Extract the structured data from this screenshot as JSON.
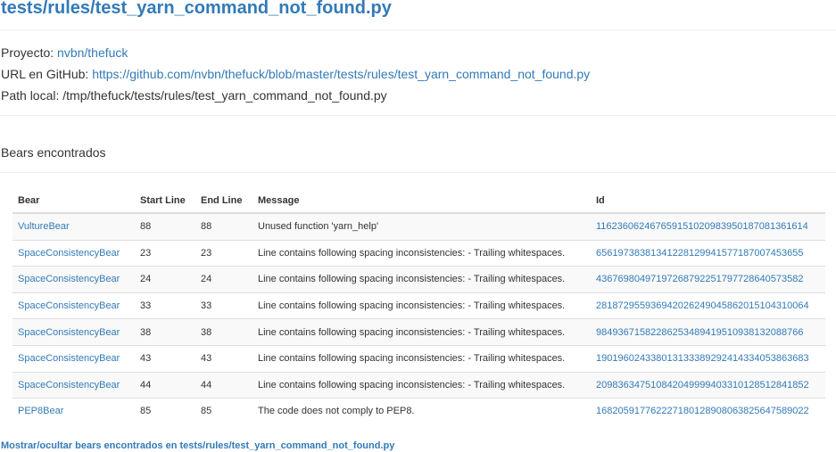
{
  "page_title": "tests/rules/test_yarn_command_not_found.py",
  "info": {
    "project_label": "Proyecto:",
    "project_value": "nvbn/thefuck",
    "github_label": "URL en GitHub:",
    "github_value": "https://github.com/nvbn/thefuck/blob/master/tests/rules/test_yarn_command_not_found.py",
    "path_label": "Path local:",
    "path_value": "/tmp/thefuck/tests/rules/test_yarn_command_not_found.py"
  },
  "bears_section": {
    "title": "Bears encontrados",
    "columns": [
      "Bear",
      "Start Line",
      "End Line",
      "Message",
      "Id"
    ],
    "rows": [
      {
        "bear": "VultureBear",
        "start": "88",
        "end": "88",
        "message": "Unused function 'yarn_help'",
        "id": "116236062467659151020983950187081361614"
      },
      {
        "bear": "SpaceConsistencyBear",
        "start": "23",
        "end": "23",
        "message": "Line contains following spacing inconsistencies: - Trailing whitespaces.",
        "id": "65619738381341228129941577187007453655"
      },
      {
        "bear": "SpaceConsistencyBear",
        "start": "24",
        "end": "24",
        "message": "Line contains following spacing inconsistencies: - Trailing whitespaces.",
        "id": "43676980497197268792251797728640573582"
      },
      {
        "bear": "SpaceConsistencyBear",
        "start": "33",
        "end": "33",
        "message": "Line contains following spacing inconsistencies: - Trailing whitespaces.",
        "id": "281872955936942026249045862015104310064"
      },
      {
        "bear": "SpaceConsistencyBear",
        "start": "38",
        "end": "38",
        "message": "Line contains following spacing inconsistencies: - Trailing whitespaces.",
        "id": "98493671582286253489419510938132088766"
      },
      {
        "bear": "SpaceConsistencyBear",
        "start": "43",
        "end": "43",
        "message": "Line contains following spacing inconsistencies: - Trailing whitespaces.",
        "id": "190196024338013133389292414334053863683"
      },
      {
        "bear": "SpaceConsistencyBear",
        "start": "44",
        "end": "44",
        "message": "Line contains following spacing inconsistencies: - Trailing whitespaces.",
        "id": "209836347510842049999403310128512841852"
      },
      {
        "bear": "PEP8Bear",
        "start": "85",
        "end": "85",
        "message": "The code does not comply to PEP8.",
        "id": "168205917762227180128908063825647589022"
      }
    ]
  },
  "toggle_link": "Mostrar/ocultar bears encontrados en tests/rules/test_yarn_command_not_found.py"
}
